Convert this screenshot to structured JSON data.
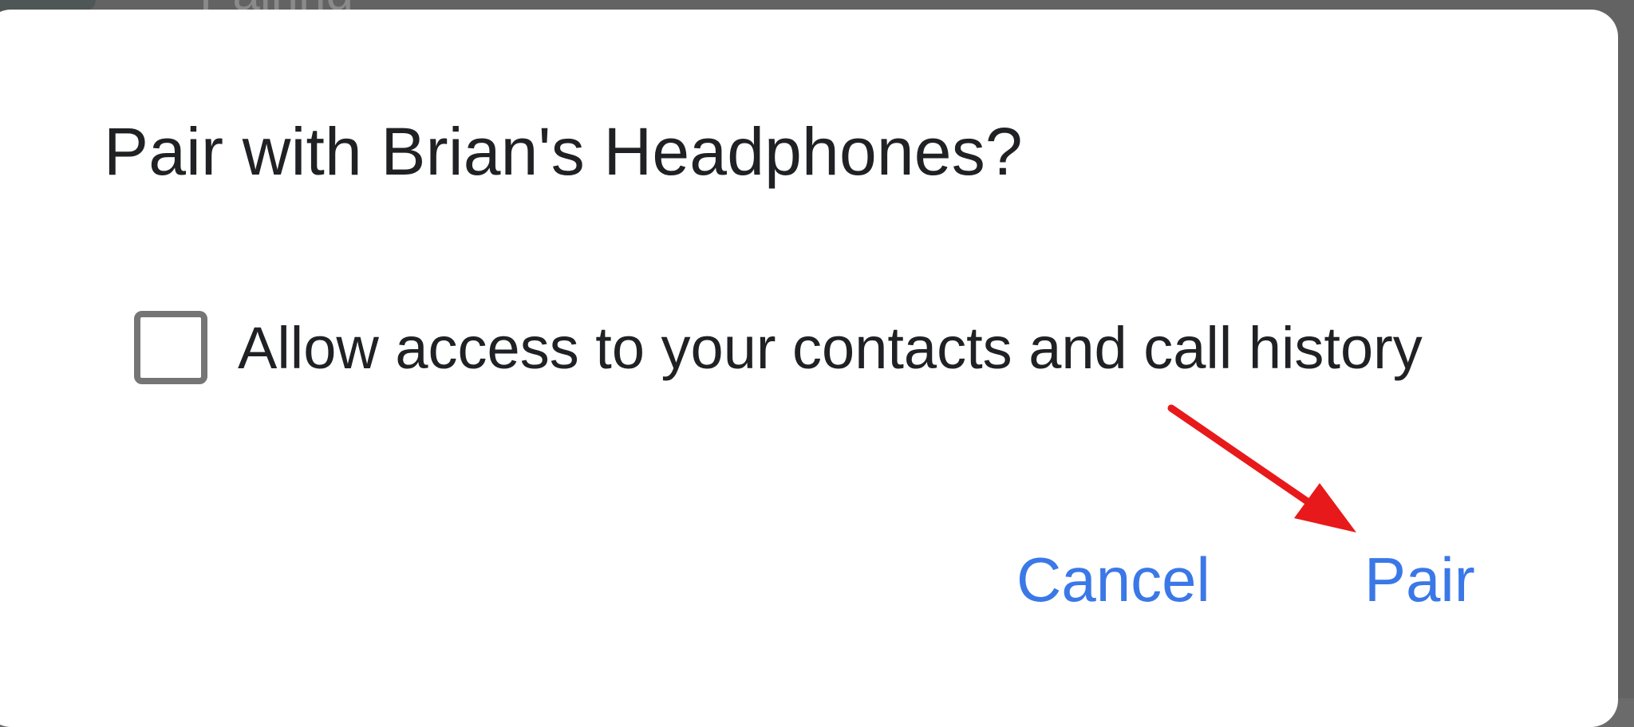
{
  "background": {
    "partial_text": "Pairing"
  },
  "dialog": {
    "title": "Pair with Brian's Headphones?",
    "checkbox": {
      "label": "Allow access to your contacts and call history",
      "checked": false
    },
    "buttons": {
      "cancel": "Cancel",
      "pair": "Pair"
    }
  },
  "colors": {
    "accent": "#3b78e7",
    "annotation_arrow": "#e8191b",
    "scrim": "#636363",
    "dialog_bg": "#ffffff"
  },
  "annotation": {
    "icon": "arrow-icon",
    "target": "pair-button"
  }
}
